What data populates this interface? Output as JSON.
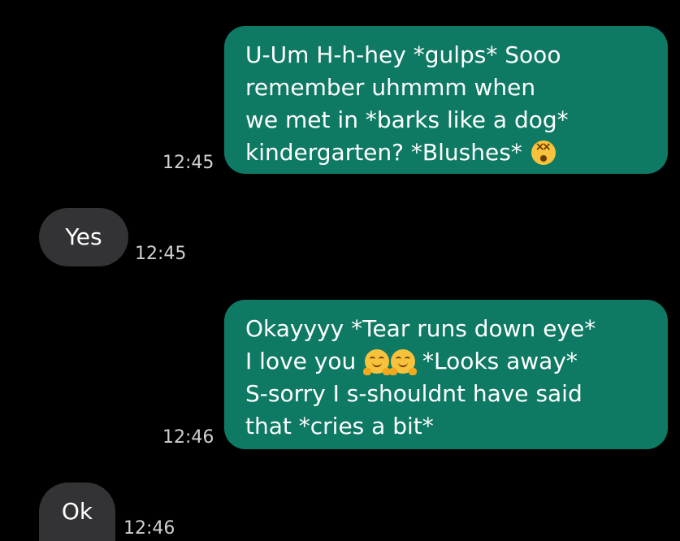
{
  "conversation": {
    "messages": [
      {
        "direction": "sent",
        "lines": [
          "U-Um H-h-hey *gulps* Sooo",
          "remember uhmmm when",
          "we met in *barks like a dog*",
          "kindergarten? *Blushes*"
        ],
        "time": "12:45",
        "emojis": [
          "dizzy-face-emoji"
        ]
      },
      {
        "direction": "received",
        "text": "Yes",
        "time": "12:45"
      },
      {
        "direction": "sent",
        "lines": [
          "Okayyyy *Tear runs down eye*",
          "I love you",
          "*Looks away*",
          "S-sorry I s-shouldnt have said",
          "that *cries a bit*"
        ],
        "time": "12:46",
        "emojis": [
          "hugging-face-emoji",
          "hugging-face-emoji"
        ]
      },
      {
        "direction": "received",
        "text": "Ok",
        "time": "12:46"
      }
    ]
  },
  "colors": {
    "background": "#000000",
    "sent_bubble": "#0f7a64",
    "received_bubble": "#333335",
    "text": "#ffffff",
    "timestamp": "#d0d0d0"
  }
}
